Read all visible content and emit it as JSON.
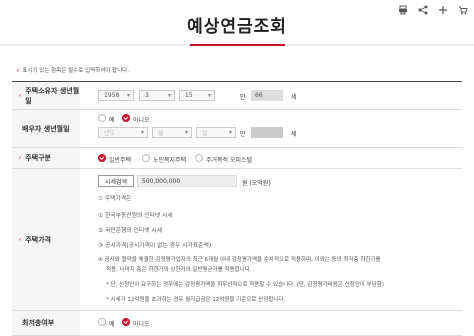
{
  "header": {
    "title": "예상연금조회"
  },
  "toolbar_icons": [
    "print-icon",
    "share-icon",
    "plus-icon",
    "cart-icon"
  ],
  "notice": {
    "text": "표시가 있는 항목은 필수로 입력하셔야 합니다."
  },
  "owner_birth": {
    "label": "주택소유자 생년월일",
    "year": "1958",
    "month": "3",
    "day": "15",
    "age_prefix": "안",
    "age_value": "66",
    "age_unit": "세"
  },
  "spouse_birth": {
    "label": "배우자 생년월일",
    "options": [
      "예",
      "아니오"
    ],
    "selected": "아니오",
    "year_placeholder": "년도",
    "month_placeholder": "월",
    "day_placeholder": "일",
    "age_prefix": "만",
    "age_unit": "세"
  },
  "house_type": {
    "label": "주택구분",
    "options": [
      "일반주택",
      "노인복지주택",
      "주거목적 오피스텔"
    ],
    "selected": "일반주택"
  },
  "house_price": {
    "label": "주택가격",
    "search_button": "시세검색",
    "amount": "500,000,000",
    "unit": "원 (오억원)",
    "sub_title": "주택가격은",
    "items": [
      "① 한국부동산원의 인터넷 시세",
      "② 국민은행의 인터넷 시세",
      "③ 공시가격(공시가격이 없는 경우 시가표준액)",
      "④ 공사와 협약을 체결한 감정평가업자의 최근 6개월 이내 감정평가액을 순차적으로 적용하며, 이와는 동의 최저층 하한가를",
      "적용, 나머지 층은 하한가와 상한가의 일반평균가를 적용합니다."
    ],
    "notes": [
      "* 단, 신청인이 요구하는 경우에는 감정평가액을 최우선적으로 적용할 수 있습니다. (단, 감정평가비용은 신청인이 부담함)",
      "* 시세가 12억원을 초과하는 경우 월지급금은 12억원을 기준으로 산정합니다."
    ]
  },
  "min_floor": {
    "label": "최저층여부",
    "options": [
      "예",
      "아니오"
    ],
    "selected": "아니오"
  },
  "colors": {
    "accent": "#c8102e"
  }
}
